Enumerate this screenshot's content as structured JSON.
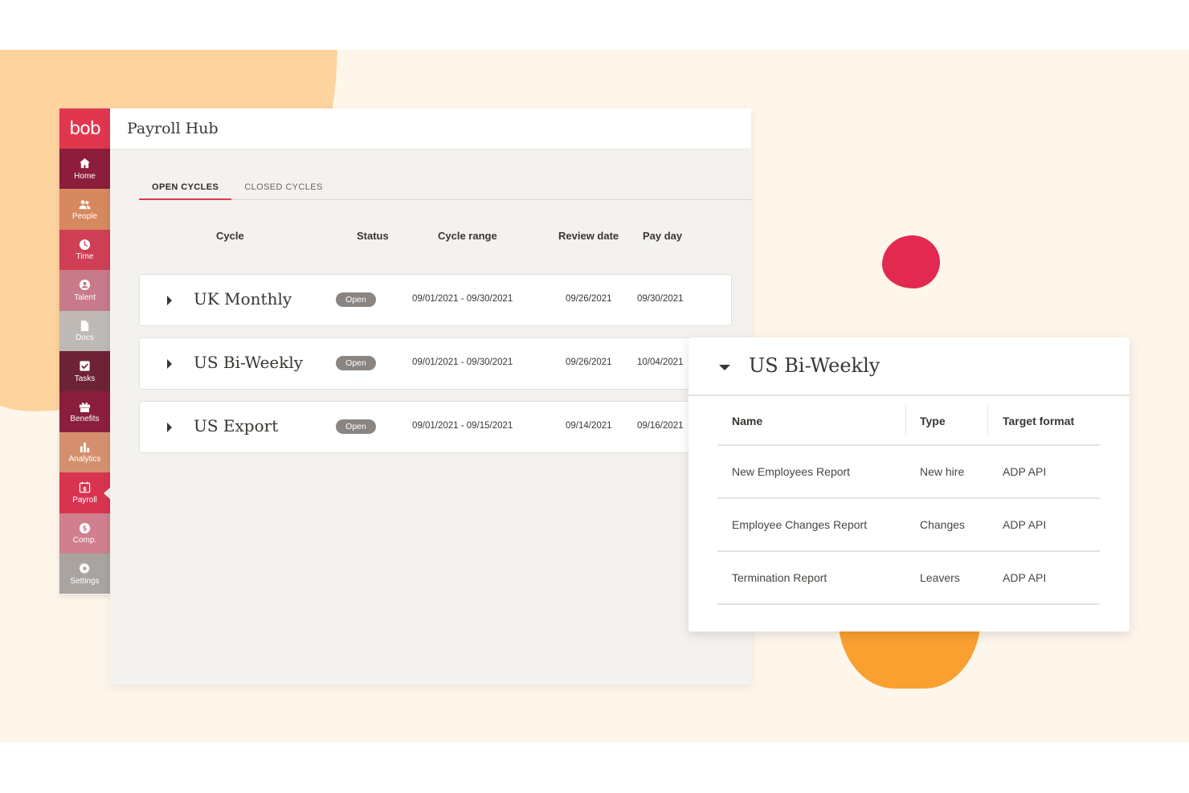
{
  "colors": {
    "background": "#fef6ea",
    "accent": "#e0374f",
    "blob_peach": "#fdd4a0",
    "blob_red": "#e2294f",
    "blob_orange": "#f9a030"
  },
  "sidebar": {
    "logo": "bob",
    "items": [
      {
        "label": "Home",
        "icon": "home-icon",
        "color": "#8c1d3b"
      },
      {
        "label": "People",
        "icon": "people-icon",
        "color": "#d6885e"
      },
      {
        "label": "Time",
        "icon": "clock-icon",
        "color": "#cf3f55"
      },
      {
        "label": "Talent",
        "icon": "person-circle-icon",
        "color": "#c77a89"
      },
      {
        "label": "Docs",
        "icon": "document-icon",
        "color": "#bfb9b5"
      },
      {
        "label": "Tasks",
        "icon": "checkbox-icon",
        "color": "#6d2336"
      },
      {
        "label": "Benefits",
        "icon": "gift-icon",
        "color": "#8a1f3d"
      },
      {
        "label": "Analytics",
        "icon": "bar-chart-icon",
        "color": "#d4906e"
      },
      {
        "label": "Payroll",
        "icon": "calendar-dollar-icon",
        "color": "#d8344f",
        "active": true
      },
      {
        "label": "Comp.",
        "icon": "dollar-circle-icon",
        "color": "#cf7f8e"
      },
      {
        "label": "Settings",
        "icon": "gear-icon",
        "color": "#a9a4a0"
      }
    ]
  },
  "header": {
    "title": "Payroll Hub"
  },
  "tabs": [
    {
      "label": "OPEN CYCLES",
      "active": true
    },
    {
      "label": "CLOSED CYCLES",
      "active": false
    }
  ],
  "columns": {
    "cycle": "Cycle",
    "status": "Status",
    "range": "Cycle range",
    "review": "Review date",
    "payday": "Pay day"
  },
  "cycles": [
    {
      "name": "UK Monthly",
      "status": "Open",
      "range": "09/01/2021 - 09/30/2021",
      "review": "09/26/2021",
      "payday": "09/30/2021"
    },
    {
      "name": "US Bi-Weekly",
      "status": "Open",
      "range": "09/01/2021 - 09/30/2021",
      "review": "09/26/2021",
      "payday": "10/04/2021"
    },
    {
      "name": "US Export",
      "status": "Open",
      "range": "09/01/2021 - 09/15/2021",
      "review": "09/14/2021",
      "payday": "09/16/2021"
    }
  ],
  "panel": {
    "title": "US Bi-Weekly",
    "headers": {
      "name": "Name",
      "type": "Type",
      "format": "Target format"
    },
    "rows": [
      {
        "name": "New Employees Report",
        "type": "New hire",
        "format": "ADP API"
      },
      {
        "name": "Employee Changes Report",
        "type": "Changes",
        "format": "ADP API"
      },
      {
        "name": "Termination Report",
        "type": "Leavers",
        "format": "ADP API"
      }
    ]
  }
}
